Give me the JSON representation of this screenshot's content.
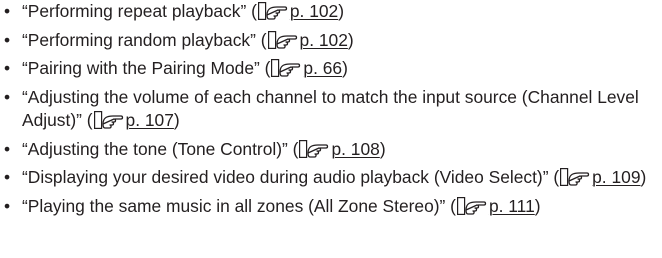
{
  "bullet": "•",
  "icon": "pointing-hand-icon",
  "items": [
    {
      "text": "“Performing repeat playback” (",
      "page": "p. 102",
      "close": ")"
    },
    {
      "text": "“Performing random playback” (",
      "page": "p. 102",
      "close": ")"
    },
    {
      "text": "“Pairing with the Pairing Mode” (",
      "page": "p. 66",
      "close": ")"
    },
    {
      "text": "“Adjusting the volume of each channel to match the input source (Channel Level Adjust)” (",
      "page": "p. 107",
      "close": ")"
    },
    {
      "text": "“Adjusting the tone (Tone Control)” (",
      "page": "p. 108",
      "close": ")"
    },
    {
      "text": "“Displaying your desired video during audio playback (Video Select)” (",
      "page": "p. 109",
      "close": ")"
    },
    {
      "text": "“Playing the same music in all zones (All Zone Stereo)” (",
      "page": "p. 111",
      "close": ")"
    }
  ]
}
